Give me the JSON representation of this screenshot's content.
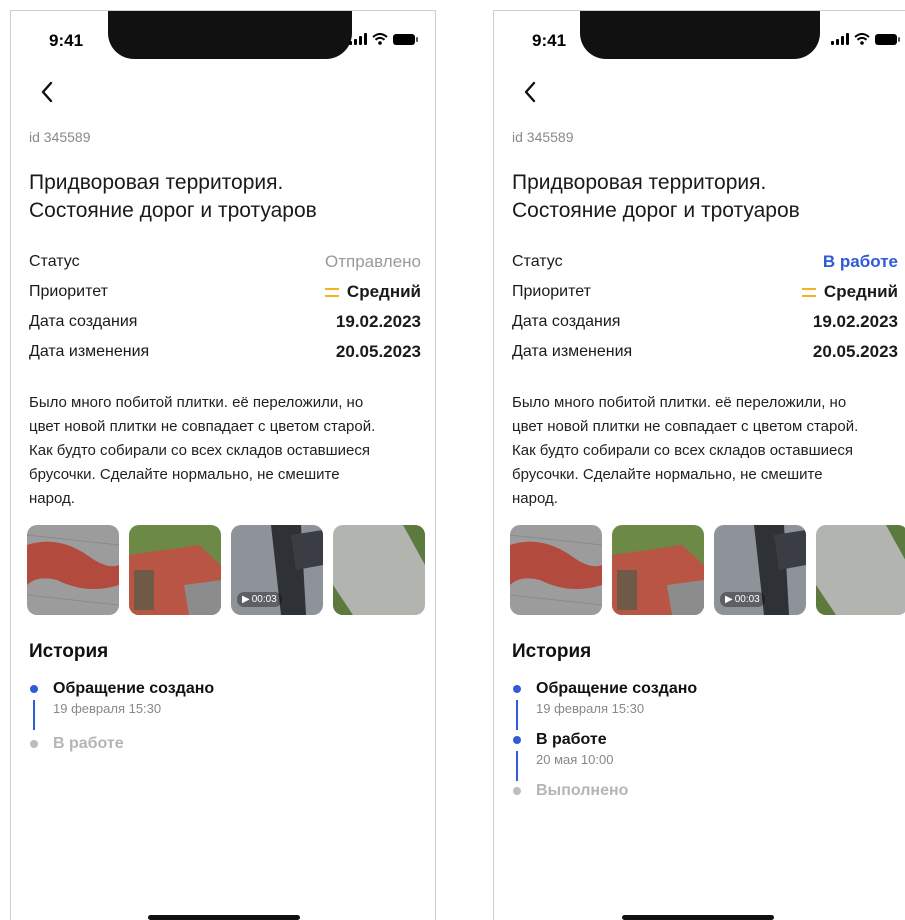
{
  "screens": [
    {
      "time": "9:41",
      "id_text": "id 345589",
      "title_line1": "Придворовая территория.",
      "title_line2": "Состояние дорог и тротуаров",
      "status_label": "Статус",
      "status_value": "Отправлено",
      "priority_label": "Приоритет",
      "priority_value": "Средний",
      "created_label": "Дата создания",
      "created_value": "19.02.2023",
      "changed_label": "Дата изменения",
      "changed_value": "20.05.2023",
      "description_lines": [
        "Было много побитой плитки. её переложили, но",
        "цвет новой плитки не совпадает с цветом старой.",
        "Как будто собирали со всех складов оставшиеся",
        "брусочки. Сделайте нормально, не смешите",
        "народ."
      ],
      "video_duration": "00:03",
      "history_title": "История",
      "history": [
        {
          "label": "Обращение создано",
          "date": "19 февраля 15:30"
        },
        {
          "label": "В работе",
          "date": ""
        }
      ]
    },
    {
      "time": "9:41",
      "id_text": "id 345589",
      "title_line1": "Придворовая территория.",
      "title_line2": "Состояние дорог и тротуаров",
      "status_label": "Статус",
      "status_value": "В работе",
      "priority_label": "Приоритет",
      "priority_value": "Средний",
      "created_label": "Дата создания",
      "created_value": "19.02.2023",
      "changed_label": "Дата изменения",
      "changed_value": "20.05.2023",
      "description_lines": [
        "Было много побитой плитки. её переложили, но",
        "цвет новой плитки не совпадает с цветом старой.",
        "Как будто собирали со всех складов оставшиеся",
        "брусочки. Сделайте нормально, не смешите",
        "народ."
      ],
      "video_duration": "00:03",
      "history_title": "История",
      "history": [
        {
          "label": "Обращение создано",
          "date": "19 февраля 15:30"
        },
        {
          "label": "В работе",
          "date": "20 мая 10:00"
        },
        {
          "label": "Выполнено",
          "date": ""
        }
      ]
    }
  ],
  "colors": {
    "accent": "#2f5bd6",
    "priority_medium": "#f5b323",
    "status_sent": "#9a9a9a",
    "pending": "#bdbdbd"
  }
}
